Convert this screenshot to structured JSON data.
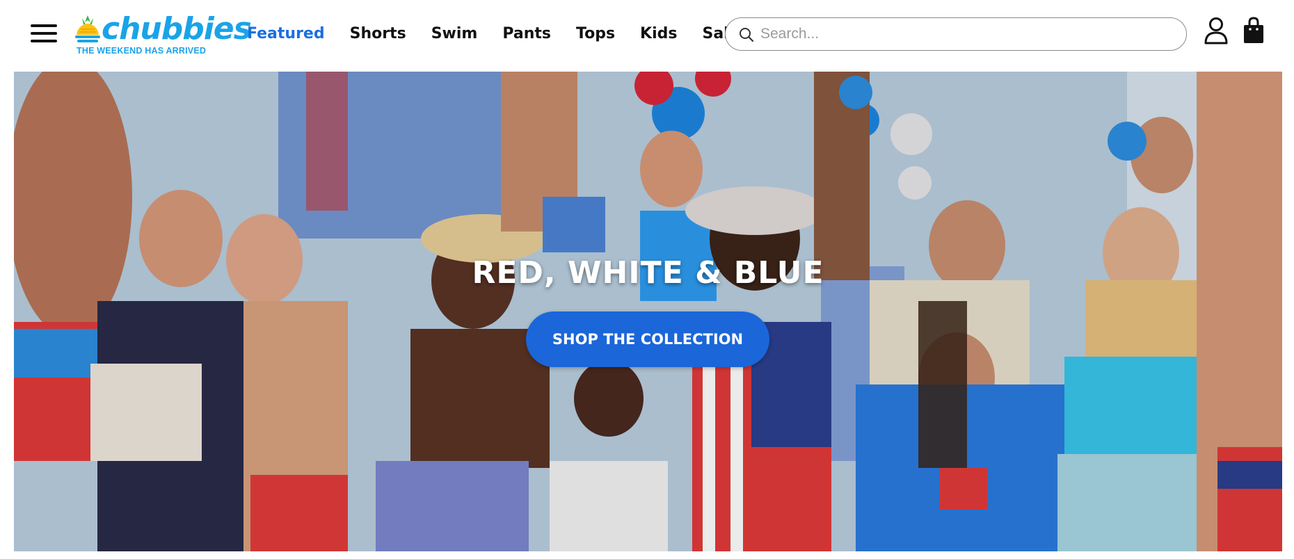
{
  "brand": {
    "name": "chubbies",
    "tagline": "THE WEEKEND HAS ARRIVED",
    "color": "#1aa3e8"
  },
  "header": {
    "menu_icon": "hamburger-menu-icon",
    "nav": [
      {
        "label": "Featured",
        "active": true
      },
      {
        "label": "Shorts",
        "active": false
      },
      {
        "label": "Swim",
        "active": false
      },
      {
        "label": "Pants",
        "active": false
      },
      {
        "label": "Tops",
        "active": false
      },
      {
        "label": "Kids",
        "active": false
      },
      {
        "label": "Sale",
        "active": false
      }
    ],
    "active_color": "#1b6fe0",
    "search": {
      "placeholder": "Search...",
      "value": "",
      "icon": "search-icon"
    },
    "account_icon": "user-icon",
    "cart_icon": "shopping-bag-icon"
  },
  "hero": {
    "title": "RED, WHITE & BLUE",
    "cta_label": "SHOP THE COLLECTION",
    "cta_color": "#1b66d9",
    "image": "group-of-people-celebrating-in-patriotic-outfits"
  }
}
